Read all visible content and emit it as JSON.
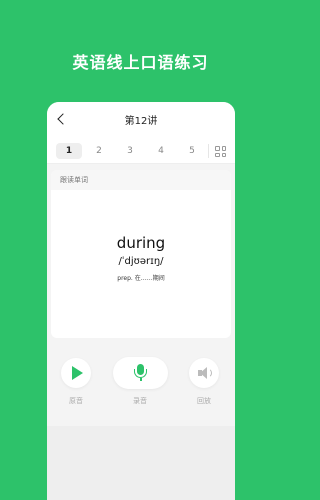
{
  "promo": {
    "title": "英语线上口语练习"
  },
  "header": {
    "title": "第12讲"
  },
  "tabs": [
    {
      "label": "1",
      "active": true
    },
    {
      "label": "2",
      "active": false
    },
    {
      "label": "3",
      "active": false
    },
    {
      "label": "4",
      "active": false
    },
    {
      "label": "5",
      "active": false
    }
  ],
  "card": {
    "header_label": "跟读单词",
    "word": "during",
    "phonetic": "/ˈdjʊərɪŋ/",
    "meaning": "prep. 在……期间"
  },
  "controls": {
    "play_label": "原音",
    "record_label": "录音",
    "playback_label": "回放"
  },
  "colors": {
    "accent": "#2dc26a",
    "background": "#2dc26a"
  }
}
